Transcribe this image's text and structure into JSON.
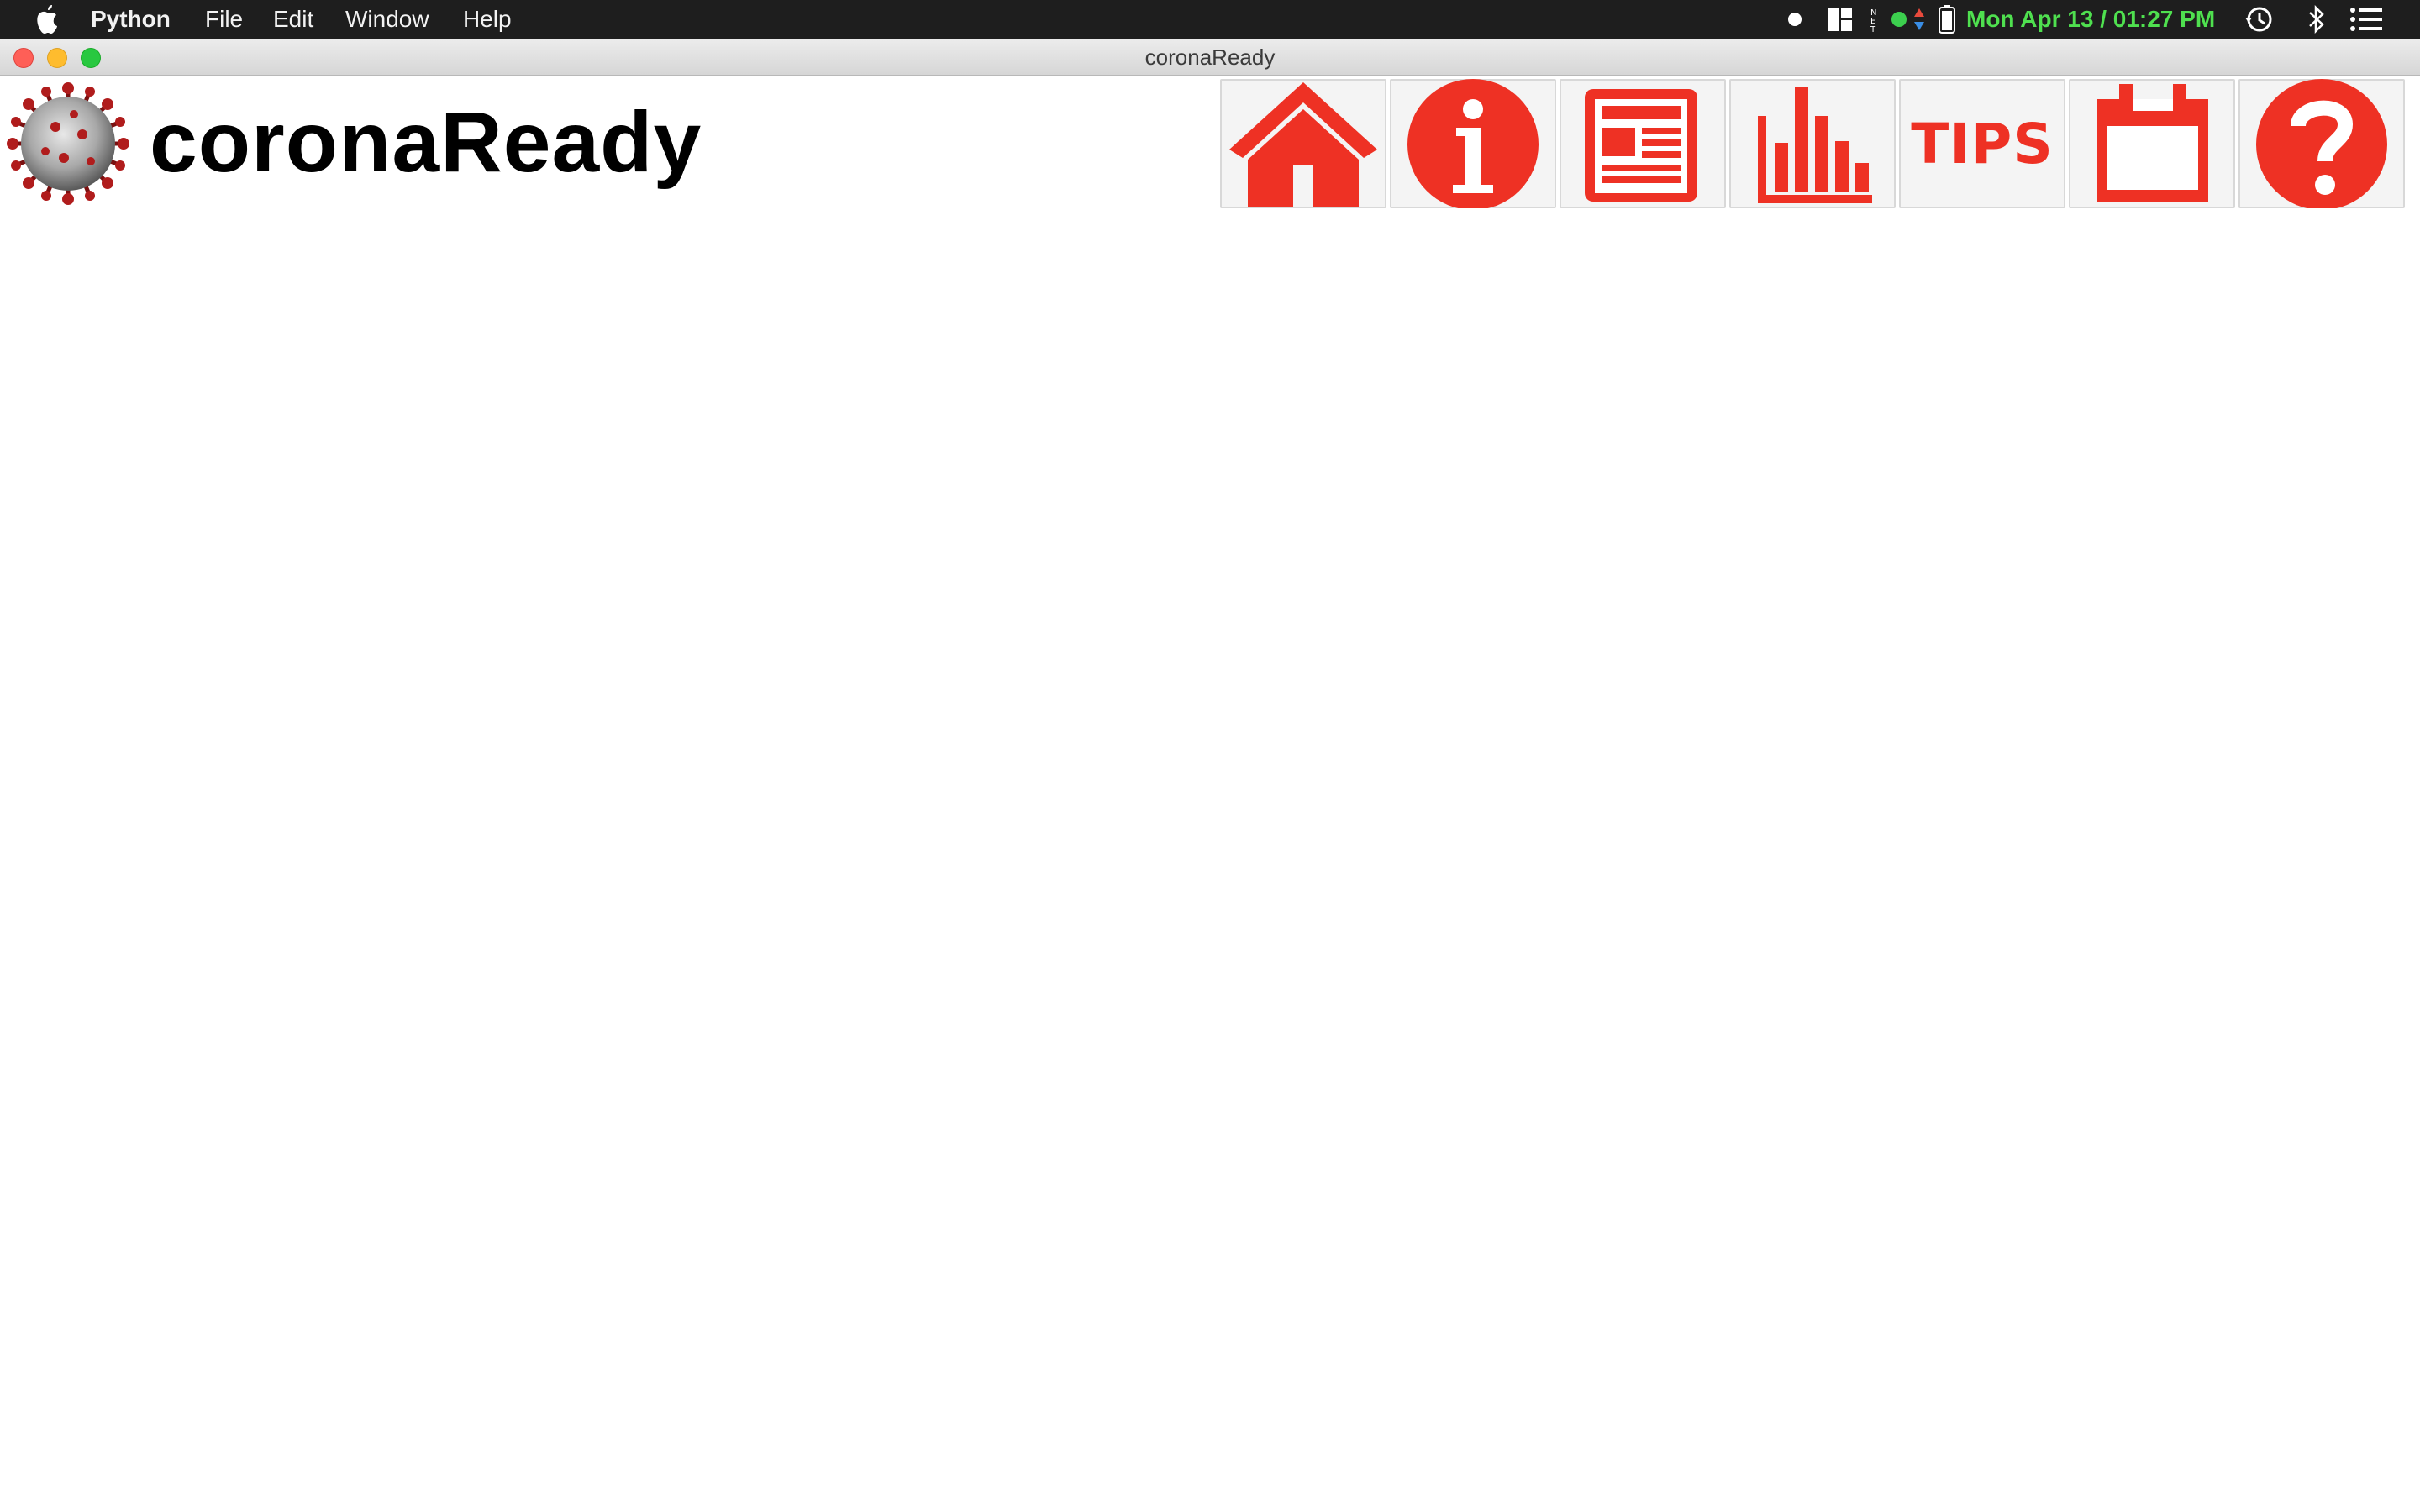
{
  "menubar": {
    "app_name": "Python",
    "items": [
      "File",
      "Edit",
      "Window",
      "Help"
    ],
    "clock": "Mon Apr 13 / 01:27 PM",
    "status_icons": [
      "record-dot-icon",
      "layout-grid-icon",
      "network-activity-icon",
      "battery-icon",
      "time-machine-icon",
      "bluetooth-icon",
      "notification-list-icon"
    ]
  },
  "window": {
    "title": "coronaReady"
  },
  "app": {
    "title": "coronaReady",
    "accent_color": "#ee3124",
    "nav": [
      {
        "name": "home",
        "icon": "home-icon"
      },
      {
        "name": "info",
        "icon": "info-icon"
      },
      {
        "name": "news",
        "icon": "newspaper-icon"
      },
      {
        "name": "stats",
        "icon": "bar-chart-icon"
      },
      {
        "name": "tips",
        "icon": "tips-icon",
        "label": "TIPS"
      },
      {
        "name": "calendar",
        "icon": "calendar-icon"
      },
      {
        "name": "help",
        "icon": "question-icon"
      }
    ]
  }
}
